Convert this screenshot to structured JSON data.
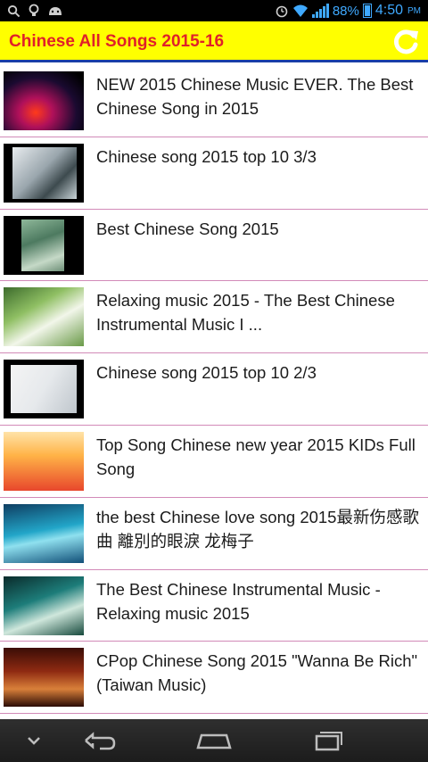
{
  "status_bar": {
    "battery": "88%",
    "time": "4:50",
    "ampm": "PM"
  },
  "app_bar": {
    "title": "Chinese All Songs 2015-16",
    "refresh_icon": "refresh-icon"
  },
  "videos": [
    {
      "title": "NEW 2015 Chinese Music EVER. The Best Chinese Song in 2015"
    },
    {
      "title": "Chinese song 2015 top 10  3/3"
    },
    {
      "title": "Best Chinese Song 2015"
    },
    {
      "title": "Relaxing music 2015 - The Best Chinese Instrumental Music I ..."
    },
    {
      "title": "Chinese song 2015 top 10  2/3"
    },
    {
      "title": "Top Song Chinese new year 2015 KIDs  Full Song"
    },
    {
      "title": "the best Chinese love song 2015最新伤感歌曲    離別的眼淚 龙梅子"
    },
    {
      "title": "The Best Chinese Instrumental Music - Relaxing music 2015"
    },
    {
      "title": "CPop Chinese Song 2015 \"Wanna Be Rich\" (Taiwan Music)"
    }
  ],
  "nav_bar": {
    "icons": [
      "hide-keyboard-icon",
      "back-icon",
      "home-icon",
      "recent-apps-icon"
    ]
  },
  "colors": {
    "app_bar_bg": "#ffff00",
    "title_color": "#e0202a",
    "divider": "#d28ab8",
    "accent_blue": "#1a3fa6"
  }
}
